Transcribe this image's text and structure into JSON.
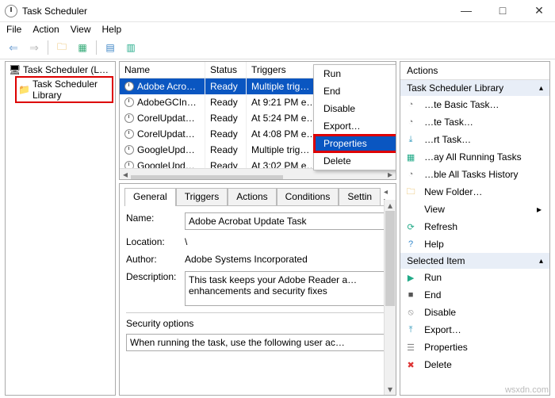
{
  "window": {
    "title": "Task Scheduler",
    "buttons": {
      "min": "—",
      "max": "□",
      "close": "✕"
    }
  },
  "menubar": [
    "File",
    "Action",
    "View",
    "Help"
  ],
  "tree": {
    "root": "Task Scheduler (Local)",
    "library": "Task Scheduler Library"
  },
  "tasklist": {
    "headers": {
      "name": "Name",
      "status": "Status",
      "triggers": "Triggers"
    },
    "rows": [
      {
        "name": "Adobe Acrob…",
        "status": "Ready",
        "triggers": "Multiple trig…"
      },
      {
        "name": "AdobeGCInv…",
        "status": "Ready",
        "triggers": "At 9:21 PM e…"
      },
      {
        "name": "CorelUpdat…",
        "status": "Ready",
        "triggers": "At 5:24 PM e…"
      },
      {
        "name": "CorelUpdat…",
        "status": "Ready",
        "triggers": "At 4:08 PM e…"
      },
      {
        "name": "GoogleUpda…",
        "status": "Ready",
        "triggers": "Multiple trig…"
      },
      {
        "name": "GoogleUpda…",
        "status": "Ready",
        "triggers": "At 3:02 PM e…"
      }
    ]
  },
  "context_menu": {
    "items": [
      "Run",
      "End",
      "Disable",
      "Export…",
      "Properties",
      "Delete"
    ],
    "highlighted": "Properties"
  },
  "tabs": [
    "General",
    "Triggers",
    "Actions",
    "Conditions",
    "Settin"
  ],
  "details": {
    "name_label": "Name:",
    "name_value": "Adobe Acrobat Update Task",
    "location_label": "Location:",
    "location_value": "\\",
    "author_label": "Author:",
    "author_value": "Adobe Systems Incorporated",
    "description_label": "Description:",
    "description_value": "This task keeps your Adobe Reader a… enhancements and security fixes",
    "security_label": "Security options",
    "security_line": "When running the task, use the following user ac…"
  },
  "actions": {
    "title": "Actions",
    "section1": "Task Scheduler Library",
    "items1": [
      {
        "icon": "clock",
        "label": "…te Basic Task…"
      },
      {
        "icon": "clock",
        "label": "…te Task…"
      },
      {
        "icon": "import",
        "label": "…rt Task…"
      },
      {
        "icon": "play",
        "label": "…ay All Running Tasks"
      },
      {
        "icon": "clock",
        "label": "…ble All Tasks History"
      },
      {
        "icon": "folder",
        "label": "New Folder…"
      },
      {
        "icon": "",
        "label": "View",
        "arrow": "▸"
      },
      {
        "icon": "refresh",
        "label": "Refresh"
      },
      {
        "icon": "help",
        "label": "Help"
      }
    ],
    "section2": "Selected Item",
    "items2": [
      {
        "icon": "runp",
        "label": "Run"
      },
      {
        "icon": "end",
        "label": "End"
      },
      {
        "icon": "disable",
        "label": "Disable"
      },
      {
        "icon": "export",
        "label": "Export…"
      },
      {
        "icon": "prop",
        "label": "Properties"
      },
      {
        "icon": "del",
        "label": "Delete"
      }
    ]
  },
  "watermark": "wsxdn.com"
}
